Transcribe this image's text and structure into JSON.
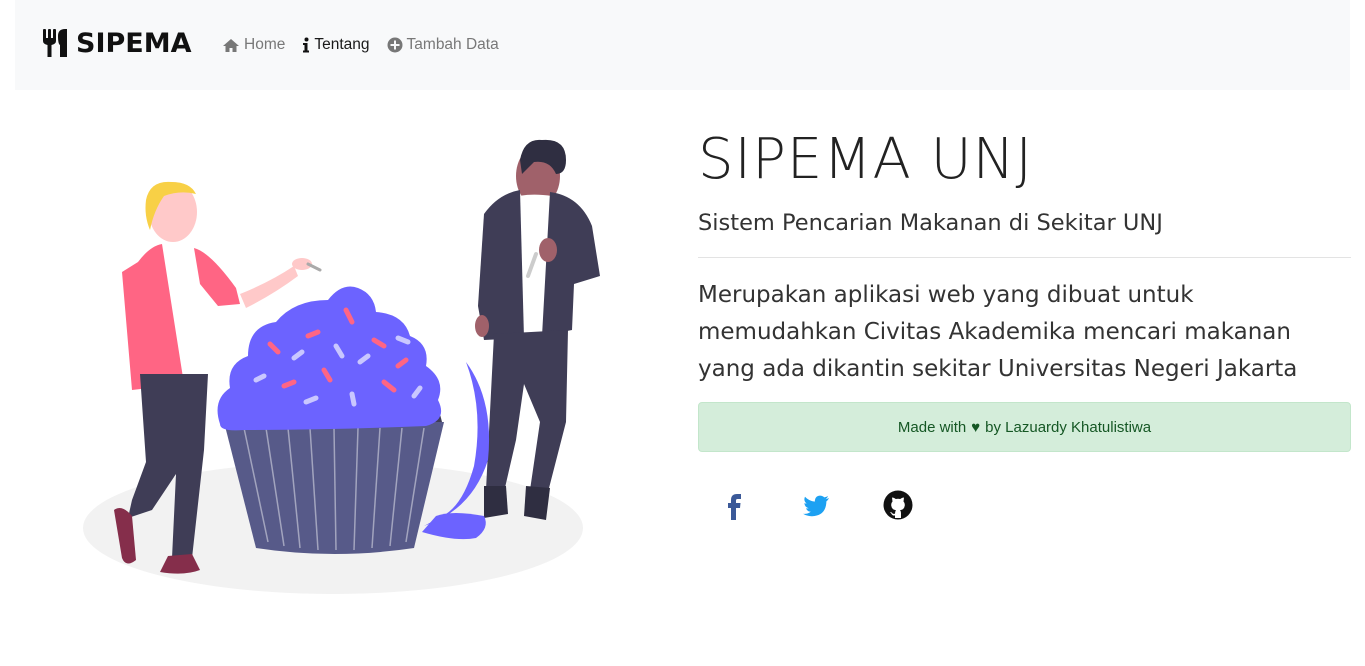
{
  "navbar": {
    "brand": "SIPEMA",
    "links": [
      {
        "label": "Home",
        "icon": "home-icon"
      },
      {
        "label": "Tentang",
        "icon": "info-icon",
        "active": true
      },
      {
        "label": "Tambah Data",
        "icon": "plus-circle-icon"
      }
    ]
  },
  "main": {
    "title": "SIPEMA UNJ",
    "subtitle": "Sistem Pencarian Makanan di Sekitar UNJ",
    "description": "Merupakan aplikasi web yang dibuat untuk memudahkan Civitas Akademika mencari makanan yang ada dikantin sekitar Universitas Negeri Jakarta",
    "credit": {
      "prefix": "Made with",
      "heart": "♥",
      "suffix": "by Lazuardy Khatulistiwa"
    },
    "social": [
      "facebook-icon",
      "twitter-icon",
      "github-icon"
    ]
  },
  "colors": {
    "navbar_bg": "#f8f9fa",
    "alert_bg": "#d4edda",
    "alert_text": "#155724",
    "facebook": "#3b5998",
    "twitter": "#1da1f2",
    "github": "#111111",
    "cupcake_frosting": "#6c63ff"
  }
}
